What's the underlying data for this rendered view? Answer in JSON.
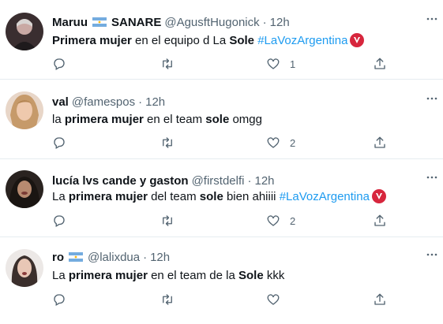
{
  "colors": {
    "text": "#0f1419",
    "muted": "#536471",
    "link": "#1d9bf0",
    "divider": "#e6ecf0",
    "badge": "#d7263d"
  },
  "icons": {
    "reply": "reply-icon",
    "retweet": "retweet-icon",
    "like": "heart-icon",
    "share": "share-icon",
    "more": "more-icon",
    "flag": "argentina-flag-icon",
    "badge": "la-voz-badge-icon"
  },
  "tweets": [
    {
      "name": "Maruu",
      "name_suffix": "SANARE",
      "has_flag": true,
      "handle": "@AgusftHugonick",
      "time": "12h",
      "text": [
        "Primera mujer",
        " en el equipo d La ",
        "Sole",
        " ",
        "#LaVozArgentina"
      ],
      "like_count": "1"
    },
    {
      "name": "val",
      "handle": "@famespos",
      "time": "12h",
      "text": [
        "la ",
        "primera mujer",
        " en el team ",
        "sole",
        " omgg"
      ],
      "like_count": "2"
    },
    {
      "name": "lucía lvs cande y gaston",
      "handle": "@firstdelfi",
      "time": "12h",
      "text": [
        "La ",
        "primera mujer",
        " del team ",
        "sole",
        " bien ahiiii ",
        "#LaVozArgentina"
      ],
      "like_count": "2"
    },
    {
      "name": "ro",
      "has_flag": true,
      "handle": "@lalixdua",
      "time": "12h",
      "text": [
        "La ",
        "primera mujer",
        " en el team de la ",
        "Sole",
        " kkk"
      ],
      "like_count": ""
    }
  ]
}
